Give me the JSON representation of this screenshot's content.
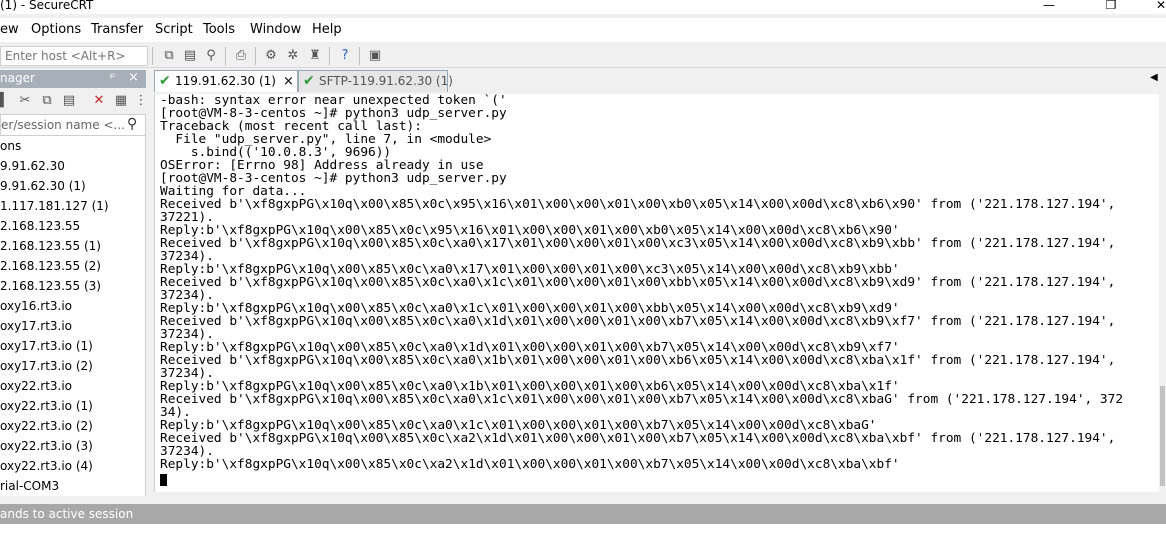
{
  "window": {
    "title": "(1) - SecureCRT",
    "minimize": "—",
    "maximize": "❐",
    "close": "✕"
  },
  "menu": [
    "ew",
    "Options",
    "Transfer",
    "Script",
    "Tools",
    "Window",
    "Help"
  ],
  "toolbar": {
    "host_placeholder": "Enter host <Alt+R>"
  },
  "session_manager": {
    "title": "nager",
    "pin": "ᵖ",
    "close": "×",
    "filter_placeholder": "er/session name <...",
    "items": [
      "ons",
      "9.91.62.30",
      "9.91.62.30 (1)",
      "1.117.181.127 (1)",
      "2.168.123.55",
      "2.168.123.55 (1)",
      "2.168.123.55 (2)",
      "2.168.123.55 (3)",
      "oxy16.rt3.io",
      "oxy17.rt3.io",
      "oxy17.rt3.io (1)",
      "oxy17.rt3.io (2)",
      "oxy22.rt3.io",
      "oxy22.rt3.io (1)",
      "oxy22.rt3.io (2)",
      "oxy22.rt3.io (3)",
      "oxy22.rt3.io (4)",
      "rial-COM3"
    ]
  },
  "tabs": [
    {
      "label": "119.91.62.30 (1)",
      "active": true,
      "close": "×"
    },
    {
      "label": "SFTP-119.91.62.30 (1)",
      "active": false
    }
  ],
  "tab_scroll": "◀",
  "terminal": {
    "lines": [
      "-bash: syntax error near unexpected token `('",
      "[root@VM-8-3-centos ~]# python3 udp_server.py",
      "Traceback (most recent call last):",
      "  File \"udp_server.py\", line 7, in <module>",
      "    s.bind(('10.0.8.3', 9696))",
      "OSError: [Errno 98] Address already in use",
      "[root@VM-8-3-centos ~]# python3 udp_server.py",
      "Waiting for data...",
      "Received b'\\xf8gxpPG\\x10q\\x00\\x85\\x0c\\x95\\x16\\x01\\x00\\x00\\x01\\x00\\xb0\\x05\\x14\\x00\\x00d\\xc8\\xb6\\x90' from ('221.178.127.194',",
      "37221).",
      "Reply:b'\\xf8gxpPG\\x10q\\x00\\x85\\x0c\\x95\\x16\\x01\\x00\\x00\\x01\\x00\\xb0\\x05\\x14\\x00\\x00d\\xc8\\xb6\\x90'",
      "Received b'\\xf8gxpPG\\x10q\\x00\\x85\\x0c\\xa0\\x17\\x01\\x00\\x00\\x01\\x00\\xc3\\x05\\x14\\x00\\x00d\\xc8\\xb9\\xbb' from ('221.178.127.194',",
      "37234).",
      "Reply:b'\\xf8gxpPG\\x10q\\x00\\x85\\x0c\\xa0\\x17\\x01\\x00\\x00\\x01\\x00\\xc3\\x05\\x14\\x00\\x00d\\xc8\\xb9\\xbb'",
      "Received b'\\xf8gxpPG\\x10q\\x00\\x85\\x0c\\xa0\\x1c\\x01\\x00\\x00\\x01\\x00\\xbb\\x05\\x14\\x00\\x00d\\xc8\\xb9\\xd9' from ('221.178.127.194',",
      "37234).",
      "Reply:b'\\xf8gxpPG\\x10q\\x00\\x85\\x0c\\xa0\\x1c\\x01\\x00\\x00\\x01\\x00\\xbb\\x05\\x14\\x00\\x00d\\xc8\\xb9\\xd9'",
      "Received b'\\xf8gxpPG\\x10q\\x00\\x85\\x0c\\xa0\\x1d\\x01\\x00\\x00\\x01\\x00\\xb7\\x05\\x14\\x00\\x00d\\xc8\\xb9\\xf7' from ('221.178.127.194',",
      "37234).",
      "Reply:b'\\xf8gxpPG\\x10q\\x00\\x85\\x0c\\xa0\\x1d\\x01\\x00\\x00\\x01\\x00\\xb7\\x05\\x14\\x00\\x00d\\xc8\\xb9\\xf7'",
      "Received b'\\xf8gxpPG\\x10q\\x00\\x85\\x0c\\xa0\\x1b\\x01\\x00\\x00\\x01\\x00\\xb6\\x05\\x14\\x00\\x00d\\xc8\\xba\\x1f' from ('221.178.127.194',",
      "37234).",
      "Reply:b'\\xf8gxpPG\\x10q\\x00\\x85\\x0c\\xa0\\x1b\\x01\\x00\\x00\\x01\\x00\\xb6\\x05\\x14\\x00\\x00d\\xc8\\xba\\x1f'",
      "Received b'\\xf8gxpPG\\x10q\\x00\\x85\\x0c\\xa0\\x1c\\x01\\x00\\x00\\x01\\x00\\xb7\\x05\\x14\\x00\\x00d\\xc8\\xbaG' from ('221.178.127.194', 372",
      "34).",
      "Reply:b'\\xf8gxpPG\\x10q\\x00\\x85\\x0c\\xa0\\x1c\\x01\\x00\\x00\\x01\\x00\\xb7\\x05\\x14\\x00\\x00d\\xc8\\xbaG'",
      "Received b'\\xf8gxpPG\\x10q\\x00\\x85\\x0c\\xa2\\x1d\\x01\\x00\\x00\\x01\\x00\\xb7\\x05\\x14\\x00\\x00d\\xc8\\xba\\xbf' from ('221.178.127.194',",
      "37234).",
      "Reply:b'\\xf8gxpPG\\x10q\\x00\\x85\\x0c\\xa2\\x1d\\x01\\x00\\x00\\x01\\x00\\xb7\\x05\\x14\\x00\\x00d\\xc8\\xba\\xbf'"
    ]
  },
  "status": {
    "text": "ands to active session"
  }
}
